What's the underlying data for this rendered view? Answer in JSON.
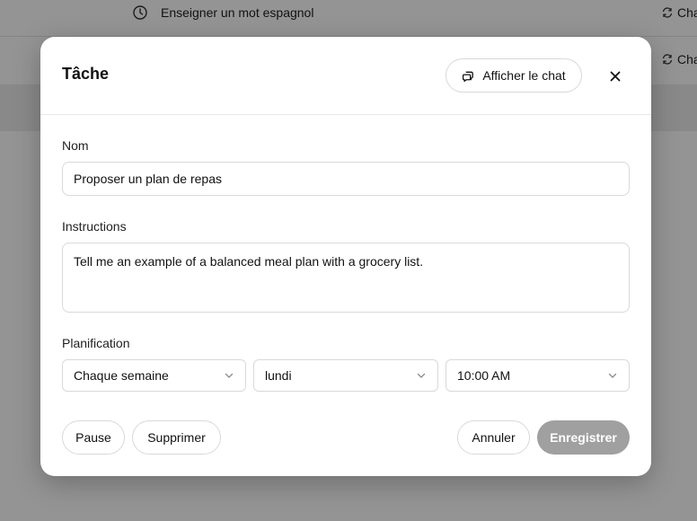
{
  "background": {
    "rows": [
      {
        "title": "Enseigner un mot espagnol",
        "frequency": "Cha"
      },
      {
        "title": "",
        "frequency": "Cha"
      }
    ]
  },
  "modal": {
    "title": "Tâche",
    "show_chat_label": "Afficher le chat",
    "name_label": "Nom",
    "name_value": "Proposer un plan de repas",
    "instructions_label": "Instructions",
    "instructions_value": "Tell me an example of a balanced meal plan with a grocery list.",
    "schedule_label": "Planification",
    "frequency_value": "Chaque semaine",
    "day_value": "lundi",
    "time_value": "10:00 AM",
    "pause_label": "Pause",
    "delete_label": "Supprimer",
    "cancel_label": "Annuler",
    "save_label": "Enregistrer"
  },
  "icons": {
    "clock": "clock-icon",
    "repeat": "repeat-icon",
    "chat": "chat-bubbles-icon",
    "close": "close-icon",
    "chevron": "chevron-down-icon"
  },
  "colors": {
    "overlay": "#00000069",
    "save_disabled_bg": "#a0a0a0",
    "border": "#d9d9d9"
  }
}
